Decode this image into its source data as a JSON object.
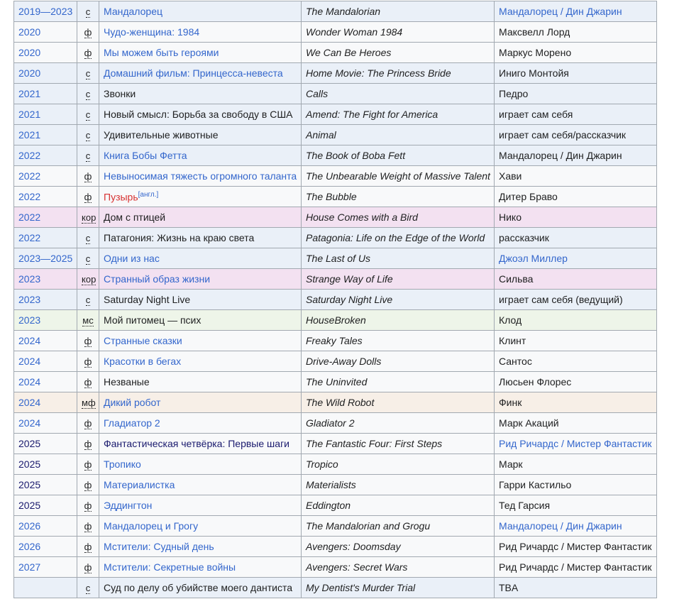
{
  "rows": [
    {
      "year": "2019—2023",
      "ys": "link",
      "type": "с",
      "title": "Мандалорец",
      "ts": "link",
      "original": "The Mandalorian",
      "role": "Мандалорец / Дин Джарин",
      "rs": "link",
      "bg": "s"
    },
    {
      "year": "2020",
      "ys": "link",
      "type": "ф",
      "title": "Чудо-женщина: 1984",
      "ts": "link",
      "original": "Wonder Woman 1984",
      "role": "Максвелл Лорд",
      "rs": "",
      "bg": "f"
    },
    {
      "year": "2020",
      "ys": "link",
      "type": "ф",
      "title": "Мы можем быть героями",
      "ts": "link",
      "original": "We Can Be Heroes",
      "role": "Маркус Морено",
      "rs": "",
      "bg": "f"
    },
    {
      "year": "2020",
      "ys": "link",
      "type": "с",
      "title": "Домашний фильм: Принцесса-невеста",
      "ts": "link",
      "original": "Home Movie: The Princess Bride",
      "role": "Иниго Монтойя",
      "rs": "",
      "bg": "s"
    },
    {
      "year": "2021",
      "ys": "link",
      "type": "с",
      "title": "Звонки",
      "ts": "",
      "original": "Calls",
      "role": "Педро",
      "rs": "",
      "bg": "s"
    },
    {
      "year": "2021",
      "ys": "link",
      "type": "с",
      "title": "Новый смысл: Борьба за свободу в США",
      "ts": "",
      "original": "Amend: The Fight for America",
      "role": "играет сам себя",
      "rs": "",
      "bg": "s"
    },
    {
      "year": "2021",
      "ys": "link",
      "type": "с",
      "title": "Удивительные животные",
      "ts": "",
      "original": "Animal",
      "role": "играет сам себя/рассказчик",
      "rs": "",
      "bg": "s"
    },
    {
      "year": "2022",
      "ys": "link",
      "type": "с",
      "title": "Книга Бобы Фетта",
      "ts": "link",
      "original": "The Book of Boba Fett",
      "role": "Мандалорец / Дин Джарин",
      "rs": "",
      "bg": "s"
    },
    {
      "year": "2022",
      "ys": "link",
      "type": "ф",
      "title": "Невыносимая тяжесть огромного таланта",
      "ts": "link",
      "original": "The Unbearable Weight of Massive Talent",
      "role": "Хави",
      "rs": "",
      "bg": "f"
    },
    {
      "year": "2022",
      "ys": "link",
      "type": "ф",
      "title": "Пузырь",
      "ts": "red",
      "sup": "[англ.]",
      "original": "The Bubble",
      "role": "Дитер Браво",
      "rs": "",
      "bg": "f"
    },
    {
      "year": "2022",
      "ys": "link",
      "type": "кор",
      "title": "Дом с птицей",
      "ts": "",
      "original": "House Comes with a Bird",
      "role": "Нико",
      "rs": "",
      "bg": "kor"
    },
    {
      "year": "2022",
      "ys": "link",
      "type": "с",
      "title": "Патагония: Жизнь на краю света",
      "ts": "",
      "original": "Patagonia: Life on the Edge of the World",
      "role": "рассказчик",
      "rs": "",
      "bg": "s"
    },
    {
      "year": "2023—2025",
      "ys": "link",
      "type": "с",
      "title": "Одни из нас",
      "ts": "link",
      "original": "The Last of Us",
      "role": "Джоэл Миллер",
      "rs": "link",
      "bg": "s"
    },
    {
      "year": "2023",
      "ys": "link",
      "type": "кор",
      "title": "Странный образ жизни",
      "ts": "link",
      "original": "Strange Way of Life",
      "role": "Сильва",
      "rs": "",
      "bg": "kor"
    },
    {
      "year": "2023",
      "ys": "link",
      "type": "с",
      "title": "Saturday Night Live",
      "ts": "",
      "original": "Saturday Night Live",
      "role": "играет сам себя (ведущий)",
      "rs": "",
      "bg": "s"
    },
    {
      "year": "2023",
      "ys": "link",
      "type": "мс",
      "title": "Мой питомец — псих",
      "ts": "",
      "original": "HouseBroken",
      "role": "Клод",
      "rs": "",
      "bg": "ms"
    },
    {
      "year": "2024",
      "ys": "link",
      "type": "ф",
      "title": "Странные сказки",
      "ts": "link",
      "original": "Freaky Tales",
      "role": "Клинт",
      "rs": "",
      "bg": "f"
    },
    {
      "year": "2024",
      "ys": "link",
      "type": "ф",
      "title": "Красотки в бегах",
      "ts": "link",
      "original": "Drive-Away Dolls",
      "role": "Сантос",
      "rs": "",
      "bg": "f"
    },
    {
      "year": "2024",
      "ys": "link",
      "type": "ф",
      "title": "Незваные",
      "ts": "",
      "original": "The Uninvited",
      "role": "Люсьен Флорес",
      "rs": "",
      "bg": "f"
    },
    {
      "year": "2024",
      "ys": "link",
      "type": "мф",
      "title": "Дикий робот",
      "ts": "link",
      "original": "The Wild Robot",
      "role": "Финк",
      "rs": "",
      "bg": "mf"
    },
    {
      "year": "2024",
      "ys": "link",
      "type": "ф",
      "title": "Гладиатор 2",
      "ts": "link",
      "original": "Gladiator 2",
      "role": "Марк Акаций",
      "rs": "",
      "bg": "f"
    },
    {
      "year": "2025",
      "ys": "visited",
      "type": "ф",
      "title": "Фантастическая четвёрка: Первые шаги",
      "ts": "visited",
      "original": "The Fantastic Four: First Steps",
      "role": "Рид Ричардс / Мистер Фантастик",
      "rs": "link",
      "bg": "f"
    },
    {
      "year": "2025",
      "ys": "visited",
      "type": "ф",
      "title": "Тропико",
      "ts": "link",
      "original": "Tropico",
      "role": "Марк",
      "rs": "",
      "bg": "f"
    },
    {
      "year": "2025",
      "ys": "visited",
      "type": "ф",
      "title": "Материалистка",
      "ts": "link",
      "original": "Materialists",
      "role": "Гарри Кастильо",
      "rs": "",
      "bg": "f"
    },
    {
      "year": "2025",
      "ys": "visited",
      "type": "ф",
      "title": "Эддингтон",
      "ts": "link",
      "original": "Eddington",
      "role": "Тед Гарсия",
      "rs": "",
      "bg": "f"
    },
    {
      "year": "2026",
      "ys": "link",
      "type": "ф",
      "title": "Мандалорец и Грогу",
      "ts": "link",
      "original": "The Mandalorian and Grogu",
      "role": "Мандалорец / Дин Джарин",
      "rs": "link",
      "bg": "f"
    },
    {
      "year": "2026",
      "ys": "link",
      "type": "ф",
      "title": "Мстители: Судный день",
      "ts": "link",
      "original": "Avengers: Doomsday",
      "role": "Рид Ричардс / Мистер Фантастик",
      "rs": "",
      "bg": "f"
    },
    {
      "year": "2027",
      "ys": "link",
      "type": "ф",
      "title": "Мстители: Секретные войны",
      "ts": "link",
      "original": "Avengers: Secret Wars",
      "role": "Рид Ричардс / Мистер Фантастик",
      "rs": "",
      "bg": "f"
    },
    {
      "year": "",
      "ys": "",
      "type": "с",
      "title": "Суд по делу об убийстве моего дантиста",
      "ts": "",
      "original": "My Dentist's Murder Trial",
      "role": "TBA",
      "rs": "",
      "bg": "s"
    }
  ]
}
